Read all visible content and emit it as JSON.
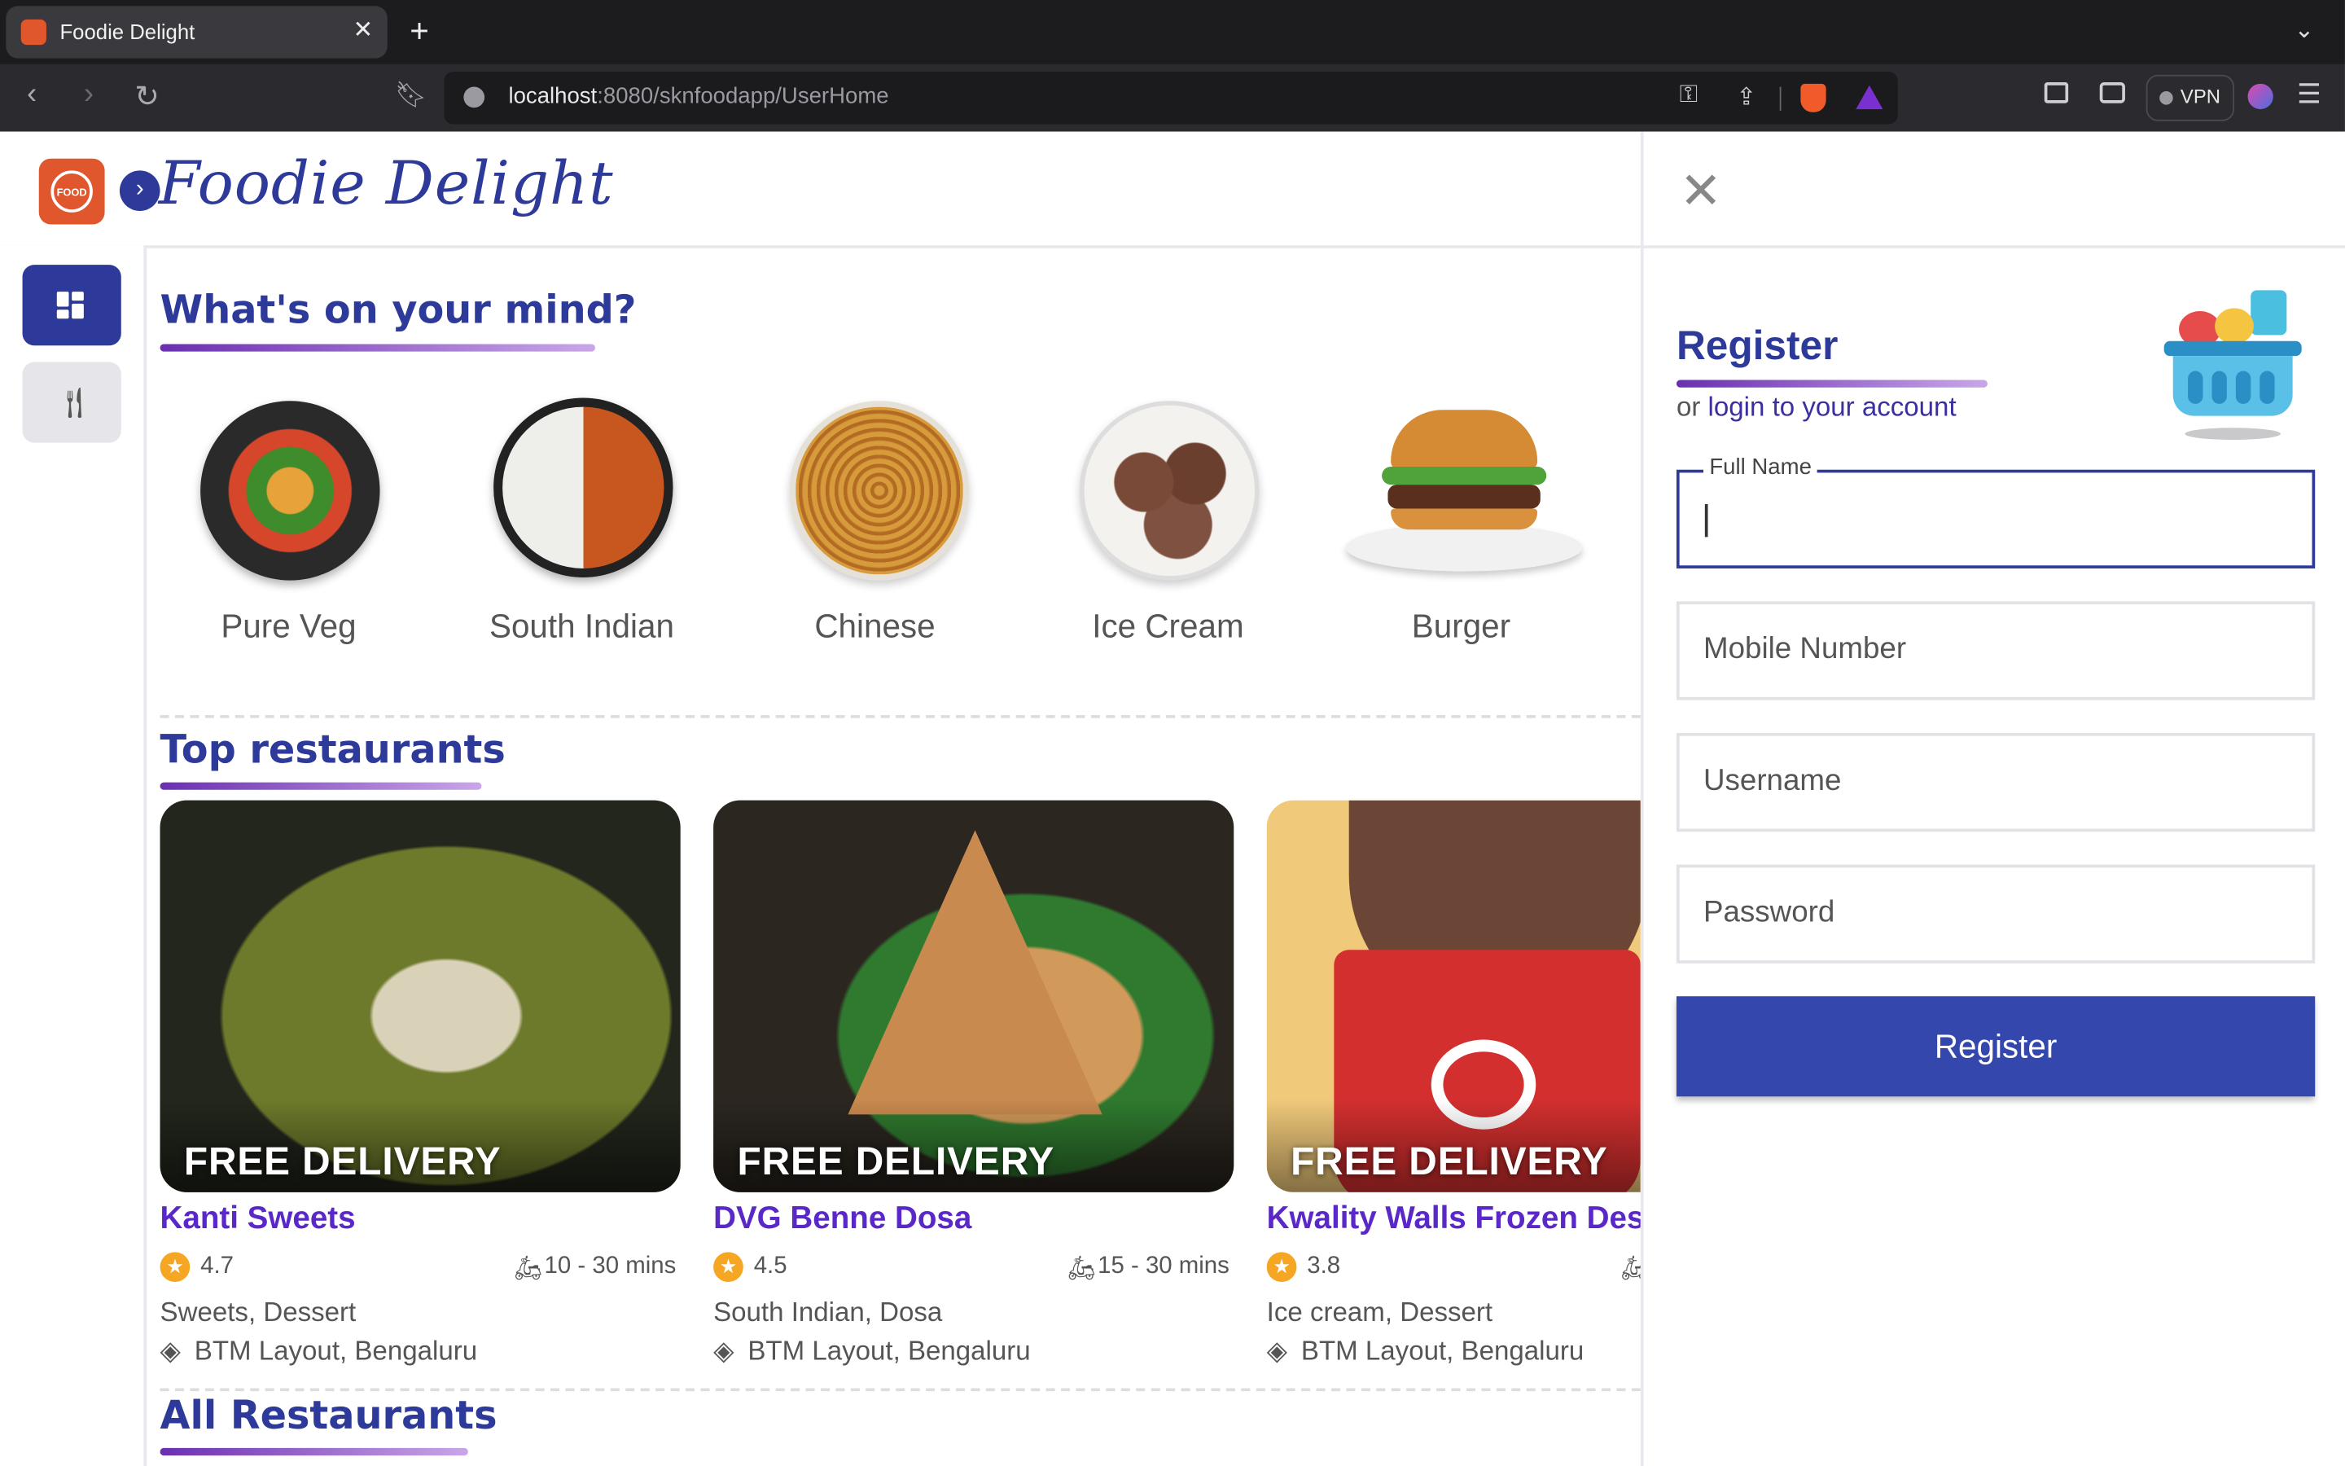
{
  "browser": {
    "tab_title": "Foodie Delight",
    "url_host": "localhost",
    "url_rest": ":8080/sknfoodapp/UserHome",
    "vpn_label": "VPN",
    "icons": [
      "back-icon",
      "forward-icon",
      "reload-icon",
      "bookmark-icon",
      "key-icon",
      "share-icon",
      "brave-shield-icon",
      "rewards-icon",
      "sidebar-icon",
      "wallet-icon",
      "profile-icon",
      "menu-icon"
    ]
  },
  "app": {
    "brand": "Foodie Delight",
    "logo_text": "FOOD",
    "toggle_glyph": "›"
  },
  "sidebar": {
    "items": [
      {
        "name": "dashboard",
        "icon": "grid-icon",
        "active": true
      },
      {
        "name": "restaurants",
        "icon": "fork-knife-icon",
        "active": false
      }
    ]
  },
  "mind": {
    "title": "What's on your mind?",
    "categories": [
      {
        "label": "Pure Veg"
      },
      {
        "label": "South Indian"
      },
      {
        "label": "Chinese"
      },
      {
        "label": "Ice Cream"
      },
      {
        "label": "Burger"
      }
    ]
  },
  "top": {
    "title": "Top restaurants",
    "restaurants": [
      {
        "badge": "FREE DELIVERY",
        "name": "Kanti Sweets",
        "rating": "4.7",
        "time": "10 - 30 mins",
        "cuisine": "Sweets, Dessert",
        "location": "BTM Layout, Bengaluru"
      },
      {
        "badge": "FREE DELIVERY",
        "name": "DVG Benne Dosa",
        "rating": "4.5",
        "time": "15 - 30 mins",
        "cuisine": "South Indian, Dosa",
        "location": "BTM Layout, Bengaluru"
      },
      {
        "badge": "FREE DELIVERY",
        "name": "Kwality Walls Frozen Des",
        "rating": "3.8",
        "time": "",
        "cuisine": "Ice cream, Dessert",
        "location": "BTM Layout, Bengaluru"
      }
    ]
  },
  "all": {
    "title": "All Restaurants"
  },
  "register": {
    "close_glyph": "✕",
    "title": "Register",
    "or_text": "or ",
    "login_link": "login to your account",
    "fields": {
      "full_name_label": "Full Name",
      "mobile_placeholder": "Mobile Number",
      "username_placeholder": "Username",
      "password_placeholder": "Password"
    },
    "button": "Register"
  },
  "colors": {
    "brand": "#2d3a9a",
    "accent": "#5a28c8",
    "logo": "#e0562d"
  }
}
